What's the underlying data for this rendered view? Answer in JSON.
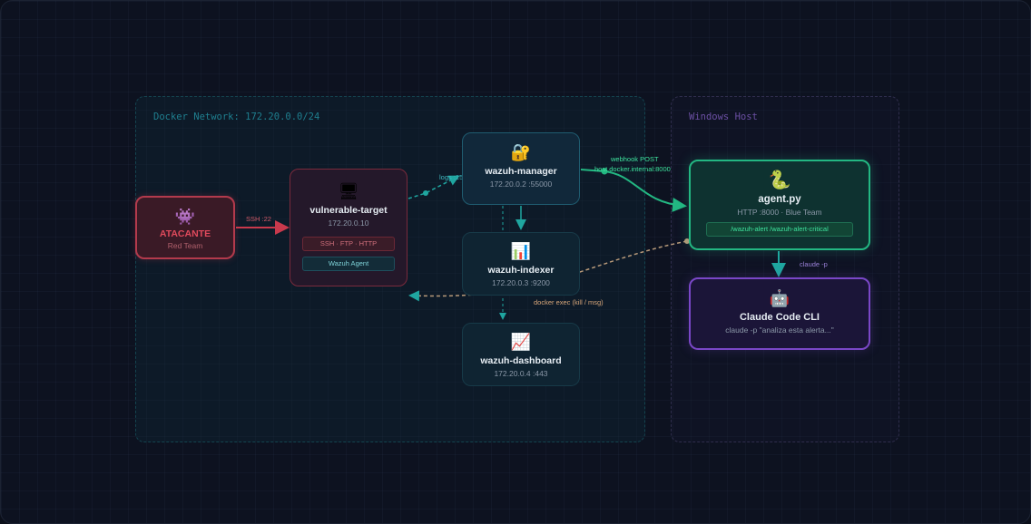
{
  "zones": {
    "docker": "Docker Network: 172.20.0.0/24",
    "windows": "Windows Host"
  },
  "nodes": {
    "attacker": {
      "icon": "👾",
      "title": "ATACANTE",
      "sub": "Red Team"
    },
    "vulnerable": {
      "icon": "🖥",
      "title": "vulnerable-target",
      "sub": "172.20.0.10",
      "tag_services": "SSH · FTP · HTTP",
      "tag_agent": "Wazuh Agent"
    },
    "manager": {
      "icon": "🔐",
      "title": "wazuh-manager",
      "sub": "172.20.0.2 :55000"
    },
    "indexer": {
      "icon": "📊",
      "title": "wazuh-indexer",
      "sub": "172.20.0.3 :9200"
    },
    "dashboard": {
      "icon": "📈",
      "title": "wazuh-dashboard",
      "sub": "172.20.0.4 :443"
    },
    "agent": {
      "icon": "🐍",
      "title": "agent.py",
      "sub": "HTTP :8000 · Blue Team",
      "endpoint": "/wazuh-alert /wazuh-alert-critical"
    },
    "claude": {
      "icon": "🤖",
      "title": "Claude Code CLI",
      "sub": "claude -p \"analiza esta alerta...\""
    }
  },
  "edges": {
    "ssh": "SSH :22",
    "logs": "logs :1514",
    "webhook_1": "webhook POST",
    "webhook_2": "host.docker.internal:8000",
    "claude_p": "claude -p",
    "docker_exec": "docker exec (kill / msg)"
  },
  "colors": {
    "attacker": "#e04a5c",
    "teal": "#1fa6a0",
    "green": "#23b782",
    "purple": "#7a47c7",
    "orange": "#c9a27a"
  }
}
